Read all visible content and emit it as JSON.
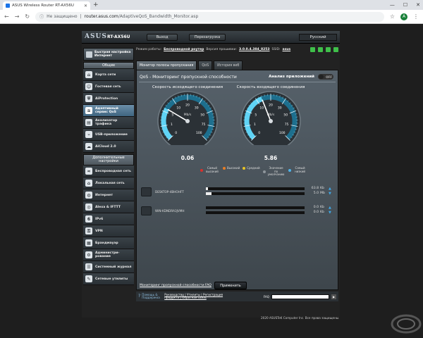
{
  "browser": {
    "tab_title": "ASUS Wireless Router RT-AX56U",
    "security_label": "Не защищено",
    "url_host": "router.asus.com",
    "url_path": "/AdaptiveQoS_Bandwidth_Monitor.asp",
    "profile_initial": "A"
  },
  "router": {
    "brand": "ASUS",
    "model": "RT-AX56U",
    "top_buttons": {
      "logout": "Выход",
      "reboot": "Перезагрузка"
    },
    "language": "Русский",
    "status": {
      "mode_label": "Режим работы:",
      "mode_value": "Беспроводной роутер",
      "fw_label": "Версия прошивки:",
      "fw_value": "3.0.0.4.384_8253",
      "ssid_label": "SSID:",
      "ssid_value": "asus"
    }
  },
  "sidebar": {
    "quick": "Быстрая настройка Интернет",
    "general_header": "Общие",
    "general_items": [
      {
        "label": "Карта сети",
        "icon": "network-map-icon"
      },
      {
        "label": "Гостевая сеть",
        "icon": "guest-network-icon"
      },
      {
        "label": "AiProtection",
        "icon": "shield-icon"
      },
      {
        "label": "Адаптивный сервис QoS",
        "icon": "qos-icon",
        "active": true
      },
      {
        "label": "Анализатор трафика",
        "icon": "traffic-analyzer-icon"
      },
      {
        "label": "USB-приложение",
        "icon": "usb-icon"
      },
      {
        "label": "AiCloud 2.0",
        "icon": "cloud-icon"
      }
    ],
    "advanced_header": "Дополнительные настройки",
    "advanced_items": [
      {
        "label": "Беспроводная сеть",
        "icon": "wireless-icon"
      },
      {
        "label": "Локальная сеть",
        "icon": "lan-icon"
      },
      {
        "label": "Интернет",
        "icon": "globe-icon"
      },
      {
        "label": "Alexa & IFTTT",
        "icon": "alexa-icon"
      },
      {
        "label": "IPv6",
        "icon": "ipv6-icon"
      },
      {
        "label": "VPN",
        "icon": "vpn-icon"
      },
      {
        "label": "Брандмауэр",
        "icon": "firewall-icon"
      },
      {
        "label": "Администри-рование",
        "icon": "admin-icon"
      },
      {
        "label": "Системный журнал",
        "icon": "log-icon"
      },
      {
        "label": "Сетевые утилиты",
        "icon": "tools-icon"
      }
    ]
  },
  "tabs": [
    "Монитор полосы пропускания",
    "QoS",
    "История веб"
  ],
  "content": {
    "title": "QoS - Мониторинг пропускной способности",
    "app_analysis_label": "Анализ приложений",
    "toggle_state": "OFF",
    "upload_label": "Скорость исходящего соединения",
    "download_label": "Скорость входящего соединения",
    "upload_value": "0.06",
    "download_value": "5.86",
    "gauge_unit": "Mb/s",
    "gauge_ticks": [
      "0",
      "1",
      "5",
      "10",
      "20",
      "30",
      "50",
      "75",
      "100"
    ],
    "upload_fraction": 0.28,
    "download_fraction": 0.42,
    "legend": [
      {
        "label": "Самый высокий",
        "color": "#d9302c"
      },
      {
        "label": "Высокий",
        "color": "#e87d25"
      },
      {
        "label": "Средний",
        "color": "#e8c325"
      },
      {
        "label": "Значение по умолчанию",
        "color": "#8e969c"
      },
      {
        "label": "Самый низкий",
        "color": "#4fb3e8"
      }
    ],
    "devices": [
      {
        "name": "DESKTOP-4BHOHFT",
        "up_rate": "63.8",
        "up_unit": "Kb",
        "down_rate": "5.0",
        "down_unit": "Mb",
        "up_fraction": 0.02,
        "down_fraction": 0.06
      },
      {
        "name": "WIN-KDNDRA3JVMH",
        "up_rate": "0.0",
        "up_unit": "Kb",
        "down_rate": "0.0",
        "down_unit": "Kb",
        "up_fraction": 0,
        "down_fraction": 0
      }
    ],
    "faq_link": "Мониторинг пропускной способности FAQ",
    "apply_label": "Применить"
  },
  "footer": {
    "help": "Помощь & Поддержка",
    "links": "Руководство | Утилиты | Регистрация продукта | Обратная связь",
    "faq_label": "FAQ"
  },
  "copyright": "2020 ASUSTeK Computer Inc. Все права защищены."
}
